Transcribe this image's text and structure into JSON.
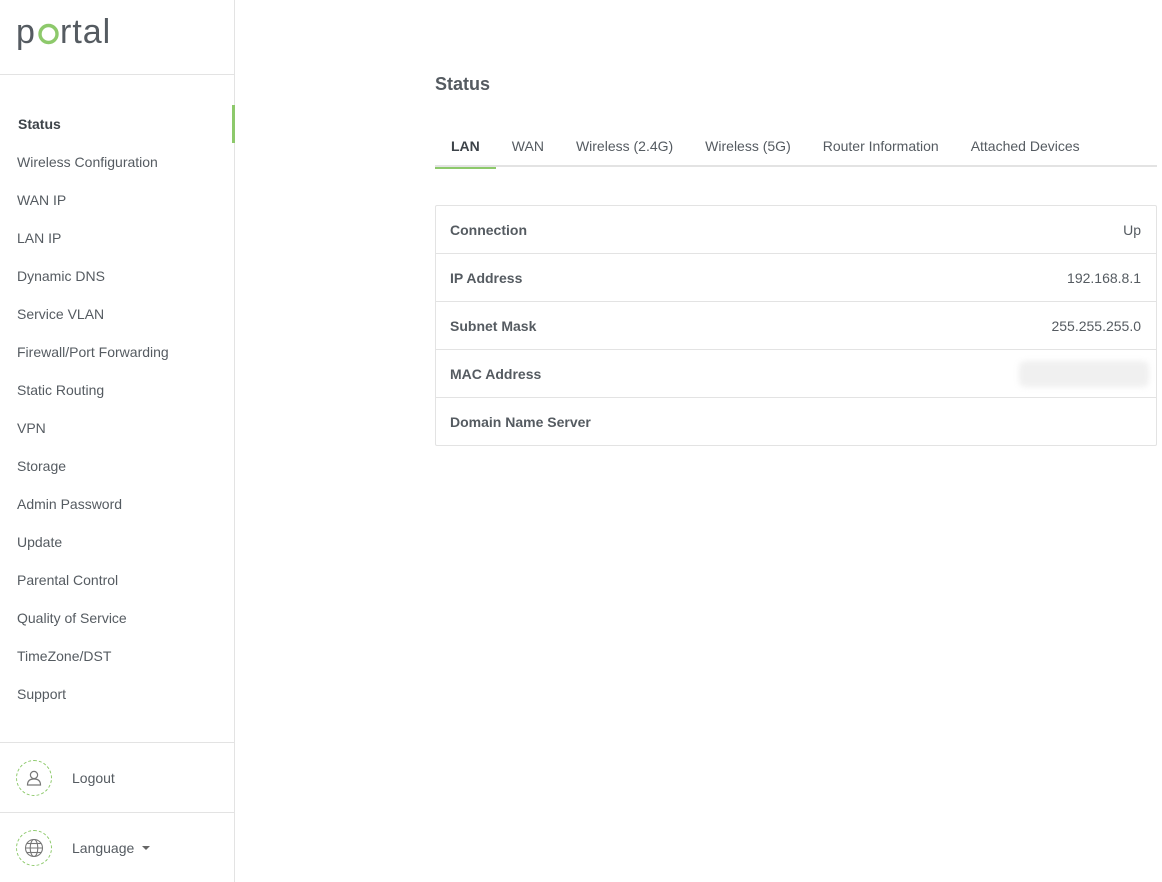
{
  "brand": {
    "logo_text": "portal",
    "accent_color": "#8dc96b"
  },
  "sidebar": {
    "items": [
      {
        "label": "Status",
        "active": true
      },
      {
        "label": "Wireless Configuration"
      },
      {
        "label": "WAN IP"
      },
      {
        "label": "LAN IP"
      },
      {
        "label": "Dynamic DNS"
      },
      {
        "label": "Service VLAN"
      },
      {
        "label": "Firewall/Port Forwarding"
      },
      {
        "label": "Static Routing"
      },
      {
        "label": "VPN"
      },
      {
        "label": "Storage"
      },
      {
        "label": "Admin Password"
      },
      {
        "label": "Update"
      },
      {
        "label": "Parental Control"
      },
      {
        "label": "Quality of Service"
      },
      {
        "label": "TimeZone/DST"
      },
      {
        "label": "Support"
      }
    ],
    "logout": {
      "label": "Logout",
      "icon": "user-icon"
    },
    "language": {
      "label": "Language",
      "icon": "globe-icon"
    }
  },
  "main": {
    "title": "Status",
    "tabs": [
      {
        "label": "LAN",
        "active": true
      },
      {
        "label": "WAN"
      },
      {
        "label": "Wireless (2.4G)"
      },
      {
        "label": "Wireless (5G)"
      },
      {
        "label": "Router Information"
      },
      {
        "label": "Attached Devices"
      }
    ],
    "lan_info": [
      {
        "label": "Connection",
        "value": "Up"
      },
      {
        "label": "IP Address",
        "value": "192.168.8.1"
      },
      {
        "label": "Subnet Mask",
        "value": "255.255.255.0"
      },
      {
        "label": "MAC Address",
        "value": "",
        "redacted": true
      },
      {
        "label": "Domain Name Server",
        "value": ""
      }
    ]
  }
}
